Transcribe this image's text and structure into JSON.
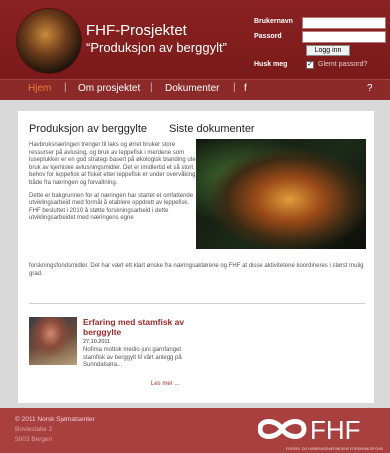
{
  "header": {
    "title": "FHF-Prosjektet",
    "subtitle": "“Produksjon av berggylt”",
    "login": {
      "username_label": "Brukernavn",
      "password_label": "Passord",
      "login_button": "Logg inn",
      "remember_label": "Husk meg",
      "remember_checked": true,
      "forgot_password": "Glemt passord?"
    }
  },
  "nav": {
    "items": [
      {
        "label": "Hjem",
        "active": true
      },
      {
        "label": "Om prosjektet",
        "active": false
      },
      {
        "label": "Dokumenter",
        "active": false
      },
      {
        "label": "?",
        "active": false
      }
    ]
  },
  "main": {
    "heading_left": "Produksjon av berggylte",
    "heading_right": "Siste dokumenter",
    "intro_paragraphs": [
      "Havbruksnæringen trenger til laks og ørret bruker store ressurser på avlusing, og bruk av leppefisk i merdene som luseplukker er en god strategi basert på økologisk blanding uten bruk av kjemiske avlusningsmidler. Det er imidlertid et så stort behov for leppefisk at fisket etter leppefisk er under overvåking både fra næringen og forvaltning.",
      "Dette er bakgrunnen for at næringen har startet et omfattende utviklingsarbeid med formål å etablere oppdrett av leppefisk. FHF besluttet i 2010 å støtte forskningsarbeid i dette utviklingsarbeidet med næringens egne"
    ],
    "intro_continuation": "forskningsfondsmidler. Det har vært ett klart ønske fra næringsaktørene og FHF at disse aktivitetene koordineres i størst mulig grad.",
    "news": {
      "title": "Erfaring med stamfisk av berggylte",
      "date": "27.10.2011",
      "text": "Nofima mottok medio juni garnfanget stamfisk av berggylt til vårt anlegg på Sunndalsøra...",
      "more_label": "Les mer ..."
    }
  },
  "footer": {
    "lines": [
      "© 2011 Norsk Sjømatsenter",
      "Boviestatie 2",
      "5003 Bergen"
    ],
    "logo_text": "FHF",
    "tagline": "FISKERI- OG HAVBRUKSNÆRINGENS FORSKNINGSFOND"
  },
  "colors": {
    "brand_red": "#8c2a2a",
    "nav_active": "#f07a36",
    "link_red": "#9c2a2a",
    "footer_red": "#a94040"
  }
}
